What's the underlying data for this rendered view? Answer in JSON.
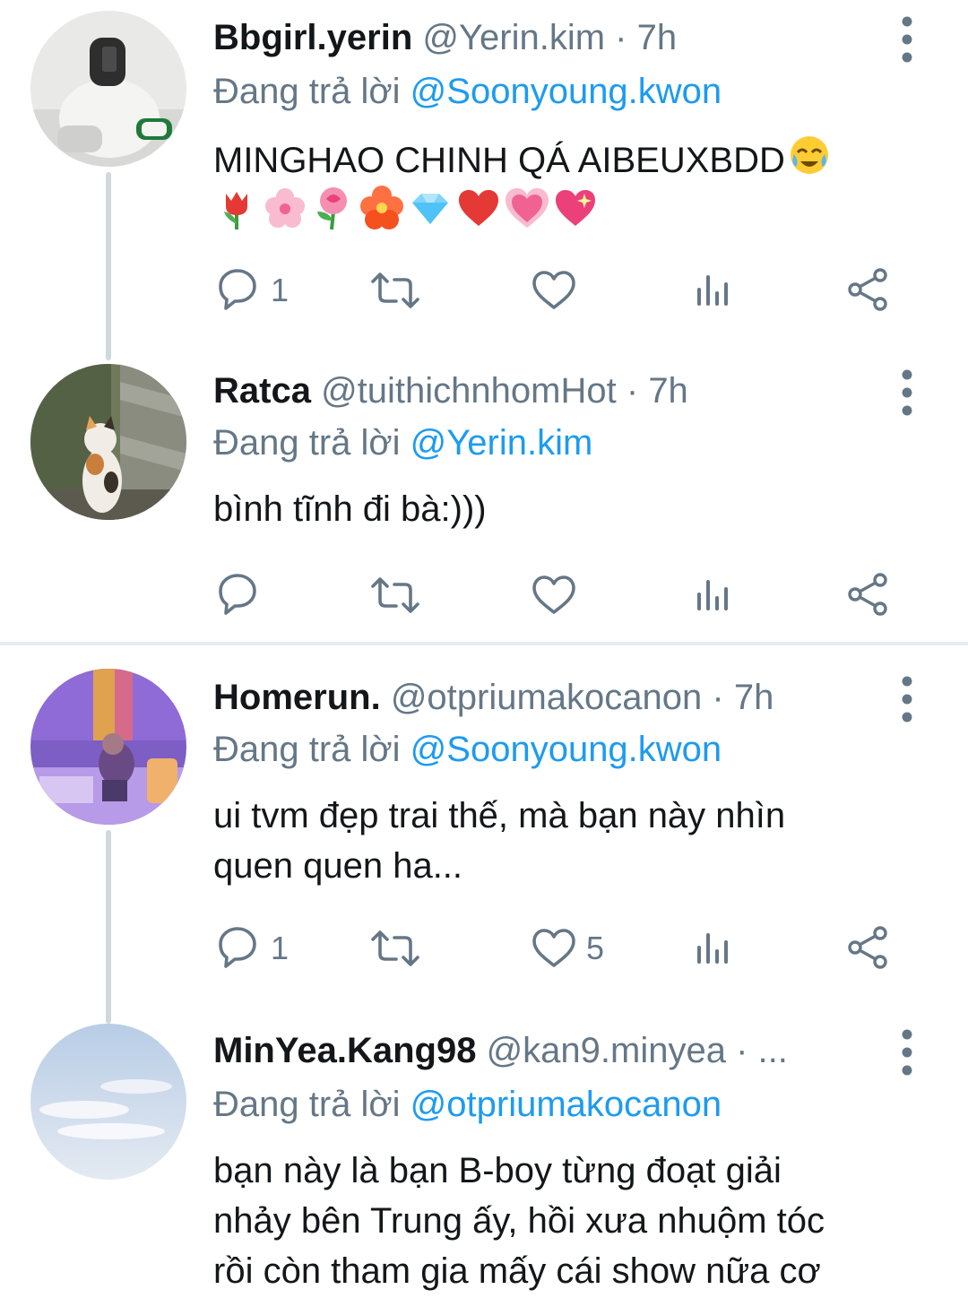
{
  "colors": {
    "accent": "#1d9bf0",
    "secondary_text": "#657786",
    "primary_text": "#14171a",
    "thread_line": "#cfd9de"
  },
  "tweets": [
    {
      "display_name": "Bbgirl.yerin",
      "handle": "@Yerin.kim",
      "separator": "·",
      "time": "7h",
      "reply_prefix": "Đang trả lời",
      "reply_to": "@Soonyoung.kwon",
      "text": "MINGHAO CHINH QÁ AIBEUXBDD",
      "emojis": [
        "crying-face-emoji",
        "tulip-emoji",
        "cherry-blossom-emoji",
        "rose-emoji",
        "hibiscus-emoji",
        "gem-emoji",
        "red-heart-emoji",
        "growing-heart-emoji",
        "sparkling-heart-emoji"
      ],
      "reply_count": "1",
      "retweet_count": "",
      "like_count": ""
    },
    {
      "display_name": "Ratca",
      "handle": "@tuithichnhomHot",
      "separator": "·",
      "time": "7h",
      "reply_prefix": "Đang trả lời",
      "reply_to": "@Yerin.kim",
      "text": "bình tĩnh đi bà:)))",
      "reply_count": "",
      "retweet_count": "",
      "like_count": ""
    },
    {
      "display_name": "Homerun.",
      "handle": "@otpriumakocanon",
      "separator": "·",
      "time": "7h",
      "reply_prefix": "Đang trả lời",
      "reply_to": "@Soonyoung.kwon",
      "text_line1": "ui tvm đẹp trai thế, mà bạn này nhìn",
      "text_line2": "quen quen ha...",
      "reply_count": "1",
      "retweet_count": "",
      "like_count": "5"
    },
    {
      "display_name": "MinYea.Kang98",
      "handle": "@kan9.minyea",
      "separator": "·",
      "time": "...",
      "reply_prefix": "Đang trả lời",
      "reply_to": "@otpriumakocanon",
      "text_line1": "bạn này là bạn B-boy từng đoạt giải",
      "text_line2": "nhảy bên Trung ấy, hồi xưa nhuộm tóc",
      "text_line3": "rồi còn tham gia mấy cái show nữa cơ"
    }
  ]
}
